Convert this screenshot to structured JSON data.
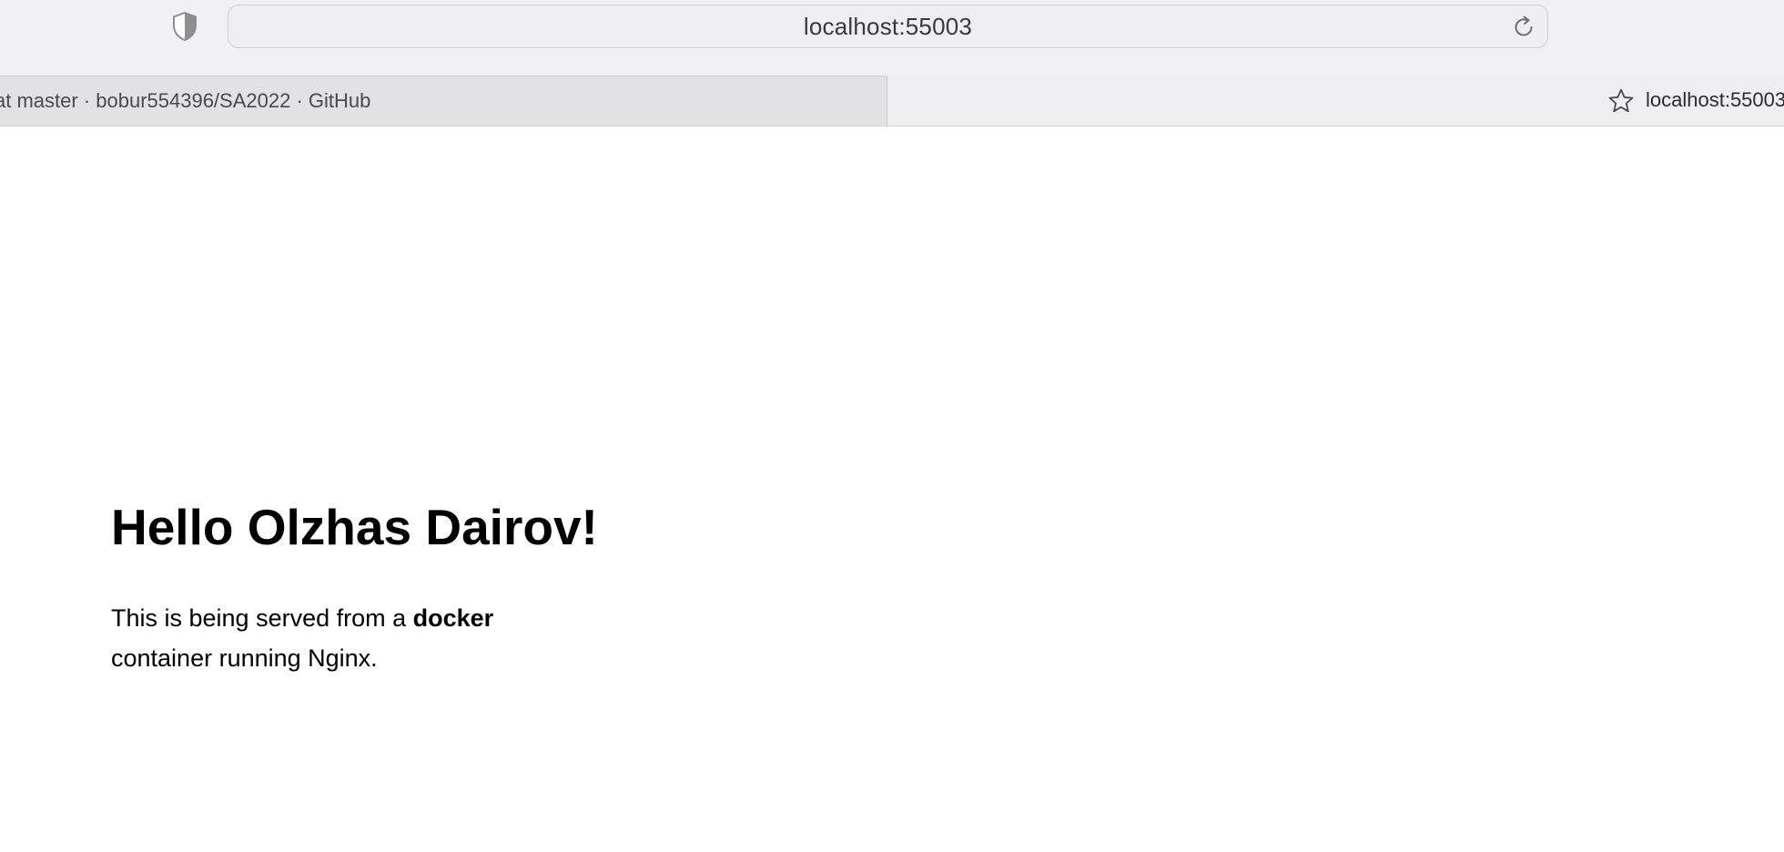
{
  "browser": {
    "address": "localhost:55003",
    "icons": {
      "privacy": "shield-icon",
      "reload": "reload-icon",
      "bookmark": "star-icon"
    },
    "tabs": [
      {
        "title": "at master · bobur554396/SA2022 · GitHub",
        "active": false
      },
      {
        "title": "localhost:55003",
        "active": true
      }
    ]
  },
  "page": {
    "heading": "Hello Olzhas Dairov!",
    "paragraph": {
      "before": "This is being served from a ",
      "bold": "docker",
      "after": " container running Nginx."
    }
  },
  "colors": {
    "toolbar_bg": "#f1f1f3",
    "inactive_tab_bg": "#e2e2e5",
    "page_bg": "#ffffff",
    "text": "#000000"
  }
}
